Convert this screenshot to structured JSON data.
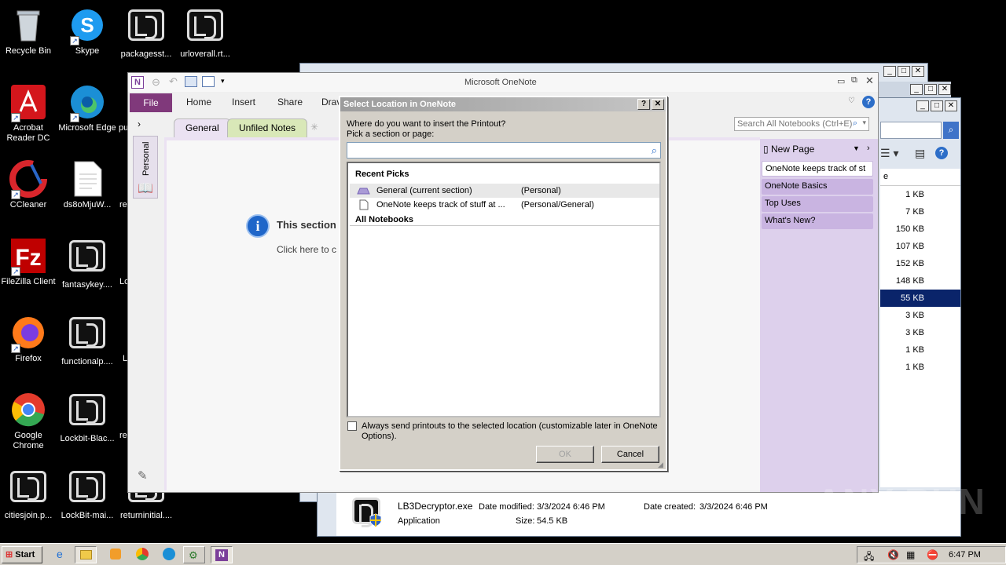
{
  "desktop_icons": [
    {
      "label": "Recycle Bin",
      "icon": "recycle-bin-icon"
    },
    {
      "label": "Skype",
      "icon": "skype-icon"
    },
    {
      "label": "packagesst...",
      "icon": "lb3-file-icon"
    },
    {
      "label": "urloverall.rt...",
      "icon": "lb3-file-icon"
    },
    {
      "label": "Acrobat Reader DC",
      "icon": "acrobat-icon"
    },
    {
      "label": "Microsoft Edge",
      "icon": "edge-icon"
    },
    {
      "label": "CCleaner",
      "icon": "ccleaner-icon"
    },
    {
      "label": "ds8oMjuW...",
      "icon": "document-icon"
    },
    {
      "label": "FileZilla Client",
      "icon": "filezilla-icon"
    },
    {
      "label": "fantasykey....",
      "icon": "lb3-file-icon"
    },
    {
      "label": "Firefox",
      "icon": "firefox-icon"
    },
    {
      "label": "functionalp....",
      "icon": "lb3-file-icon"
    },
    {
      "label": "Google Chrome",
      "icon": "chrome-icon"
    },
    {
      "label": "Lockbit-Blac...",
      "icon": "lb3-file-icon"
    },
    {
      "label": "citiesjoin.p...",
      "icon": "lb3-file-icon"
    },
    {
      "label": "LockBit-mai...",
      "icon": "lb3-file-icon"
    },
    {
      "label": "returninitial....",
      "icon": "lb3-file-icon"
    }
  ],
  "desktop_partial_labels": {
    "pu": "pu",
    "re1": "re",
    "lo": "Lo",
    "l": "L",
    "re2": "re"
  },
  "explorer": {
    "sizes": [
      "1 KB",
      "7 KB",
      "150 KB",
      "107 KB",
      "152 KB",
      "148 KB",
      "55 KB",
      "3 KB",
      "3 KB",
      "1 KB",
      "1 KB"
    ],
    "col_header": "e",
    "details": {
      "filename": "LB3Decryptor.exe",
      "type": "Application",
      "modified_label": "Date modified:",
      "modified": "3/3/2024 6:46 PM",
      "created_label": "Date created:",
      "created": "3/3/2024 6:46 PM",
      "size_label": "Size:",
      "size": "54.5 KB"
    }
  },
  "onenote": {
    "title": "Microsoft OneNote",
    "ribbon_tabs": [
      "File",
      "Home",
      "Insert",
      "Share",
      "Drav"
    ],
    "section_tabs": [
      "General",
      "Unfiled Notes"
    ],
    "notebook_label": "Personal",
    "search_placeholder": "Search All Notebooks (Ctrl+E)",
    "new_page": "New Page",
    "pages": [
      "OneNote keeps track of st",
      "OneNote Basics",
      "Top Uses",
      "What's New?"
    ],
    "info_title": "This section",
    "info_link": "Click here to c"
  },
  "dialog": {
    "title": "Select Location in OneNote",
    "prompt1": "Where do you want to insert the Printout?",
    "prompt2": "Pick a section or page:",
    "recent_heading": "Recent Picks",
    "recent": [
      {
        "name": "General (current section)",
        "location": "(Personal)"
      },
      {
        "name": "OneNote keeps track of stuff at ...",
        "location": "(Personal/General)"
      }
    ],
    "all_heading": "All Notebooks",
    "checkbox_label": "Always send printouts to the selected location (customizable later in OneNote Options).",
    "ok": "OK",
    "cancel": "Cancel"
  },
  "taskbar": {
    "start": "Start",
    "clock": "6:47 PM"
  },
  "watermark": "ANY RUN"
}
